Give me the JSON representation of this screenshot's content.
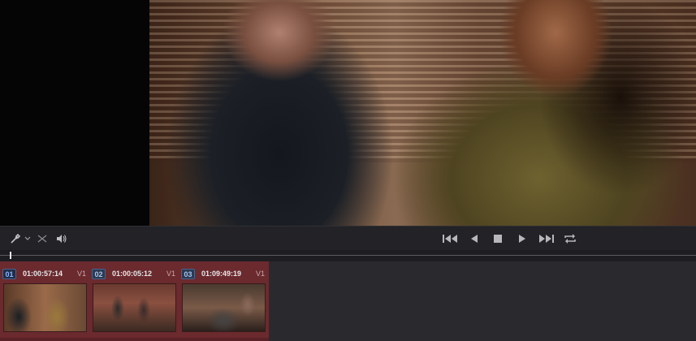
{
  "viewer": {
    "label": "Video viewer frame"
  },
  "transport": {
    "icons": {
      "eyedropper": "eyedropper-icon",
      "dropdown": "chevron-down-icon",
      "bypass": "crossed-arrows-icon",
      "audio": "speaker-icon",
      "first": "skip-to-start-icon",
      "back": "play-reverse-icon",
      "stop": "stop-icon",
      "forward": "play-icon",
      "last": "skip-to-end-icon",
      "loop": "loop-icon"
    }
  },
  "clips": [
    {
      "number": "01",
      "timecode": "01:00:57:14",
      "track": "V1"
    },
    {
      "number": "02",
      "timecode": "01:00:05:12",
      "track": "V1"
    },
    {
      "number": "03",
      "timecode": "01:09:49:19",
      "track": "V1"
    }
  ],
  "colors": {
    "strip": "#6b2a2e",
    "clip_badge": "#2c3a52",
    "background": "#1e1e22"
  }
}
